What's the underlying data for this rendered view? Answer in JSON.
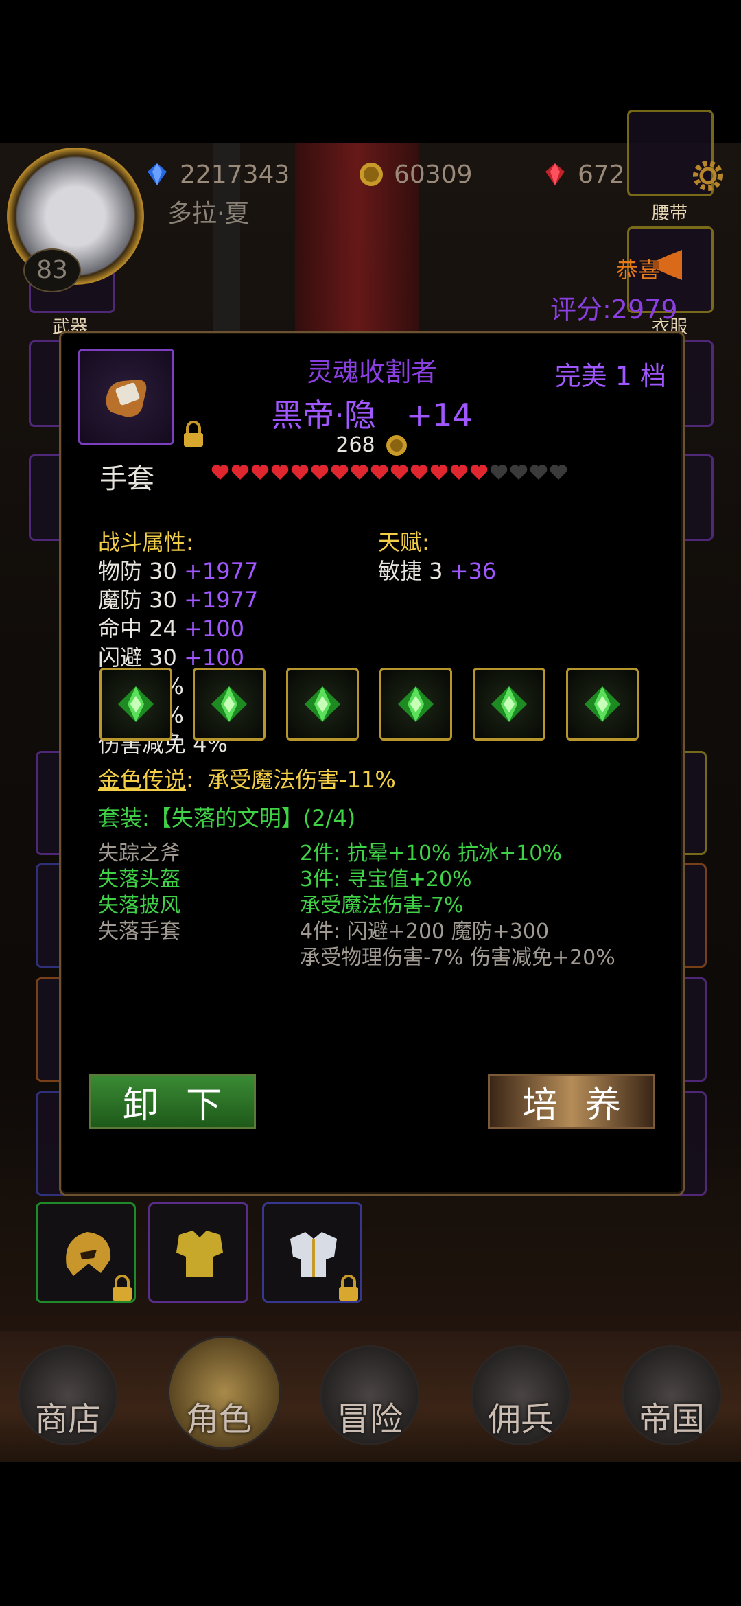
{
  "header": {
    "resources": [
      {
        "icon": "blue-gem-icon",
        "value": "2217343"
      },
      {
        "icon": "gold-coin-icon",
        "value": "60309"
      },
      {
        "icon": "red-gem-icon",
        "value": "672"
      }
    ],
    "player_name": "多拉·夏",
    "player_level": "83",
    "score": "评分:2979",
    "scroll_text": "恭喜"
  },
  "side_labels": {
    "weapon": "武器",
    "belt": "腰带",
    "clothes": "衣服"
  },
  "item": {
    "name": "灵魂收割者",
    "quality": "完美 1 档",
    "sub_name": "黑帝·隐",
    "enhance": "+14",
    "price": "268",
    "slot_type": "手套",
    "hearts_filled": 14,
    "hearts_total": 18
  },
  "combat_stats": {
    "title": "战斗属性:",
    "rows": [
      {
        "label": "物防 30",
        "bonus": "+1977"
      },
      {
        "label": "魔防 30",
        "bonus": "+1977"
      },
      {
        "label": "命中 24",
        "bonus": "+100"
      },
      {
        "label": "闪避 30",
        "bonus": "+100"
      },
      {
        "label": "抗冰 8%",
        "bonus": ""
      },
      {
        "label": "抗封 5%",
        "bonus": ""
      },
      {
        "label": "伤害减免 4%",
        "bonus": ""
      }
    ]
  },
  "talent": {
    "title": "天赋:",
    "rows": [
      {
        "label": "敏捷 3",
        "bonus": "+36"
      }
    ]
  },
  "legend": {
    "label": "金色传说",
    "separator": ":",
    "text": "承受魔法伤害-11%"
  },
  "set": {
    "title": "套装:【失落的文明】(2/4)",
    "pieces": [
      {
        "name": "失踪之斧",
        "owned": false
      },
      {
        "name": "失落头盔",
        "owned": true
      },
      {
        "name": "失落披风",
        "owned": true
      },
      {
        "name": "失落手套",
        "owned": false
      }
    ],
    "bonuses": [
      {
        "text": "2件:  抗晕+10% 抗冰+10%",
        "active": true
      },
      {
        "text": "3件:  寻宝值+20%",
        "active": true
      },
      {
        "text": "承受魔法伤害-7%",
        "active": true
      },
      {
        "text": "4件:  闪避+200 魔防+300",
        "active": false
      },
      {
        "text": "承受物理伤害-7% 伤害减免+20%",
        "active": false
      }
    ]
  },
  "gems": [
    "green-gem-icon",
    "green-gem-icon",
    "green-gem-icon",
    "green-gem-icon",
    "green-gem-icon",
    "green-gem-icon"
  ],
  "buttons": {
    "unequip": "卸下",
    "train": "培养"
  },
  "nav": [
    {
      "label": "商店",
      "icon": "castle-icon"
    },
    {
      "label": "角色",
      "icon": "hood-icon"
    },
    {
      "label": "冒险",
      "icon": "crossed-swords-icon"
    },
    {
      "label": "佣兵",
      "icon": "card-icon"
    },
    {
      "label": "帝国",
      "icon": "crown-icon"
    }
  ],
  "colors": {
    "purple_text": "#8a3fe0",
    "yellow_text": "#f3ce47",
    "green_text": "#3fd247",
    "gray_text": "#a09a92"
  }
}
